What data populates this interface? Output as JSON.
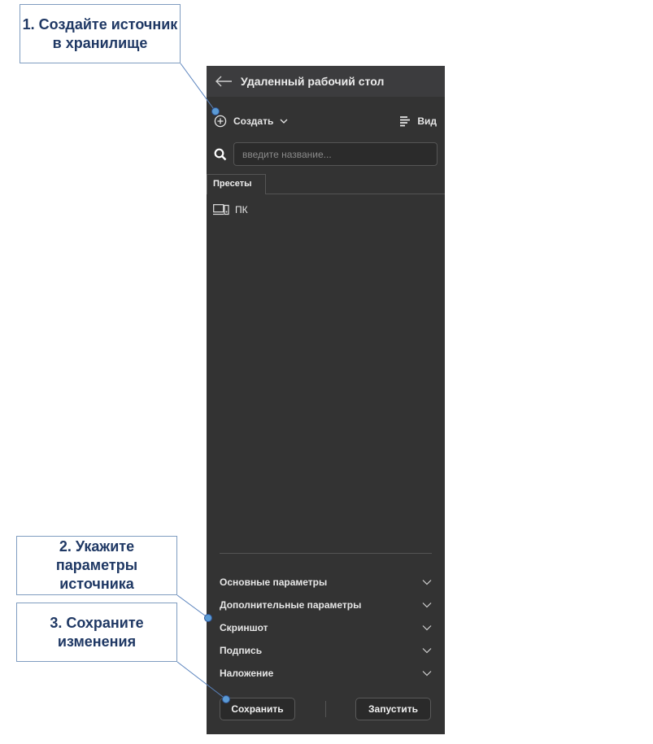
{
  "callouts": {
    "step1_line1": "1. Создайте источник",
    "step1_line2": "в хранилище",
    "step2_line1": "2. Укажите параметры",
    "step2_line2": "источника",
    "step3_line1": "3. Сохраните",
    "step3_line2": "изменения"
  },
  "panel": {
    "title": "Удаленный рабочий стол",
    "create_label": "Создать",
    "view_label": "Вид",
    "search_placeholder": "введите название...",
    "tab_label": "Пресеты",
    "preset_item": "ПК",
    "sections": [
      "Основные параметры",
      "Дополнительные параметры",
      "Скриншот",
      "Подпись",
      "Наложение"
    ],
    "save_label": "Сохранить",
    "run_label": "Запустить"
  },
  "colors": {
    "panel_bg": "#333333",
    "header_bg": "#3c3c3e",
    "callout_text": "#1f3864",
    "connector": "#5a83bd"
  },
  "icons": [
    "back-arrow-icon",
    "add-circle-icon",
    "chevron-down-icon",
    "view-lines-icon",
    "search-icon",
    "remote-desktop-icon"
  ]
}
